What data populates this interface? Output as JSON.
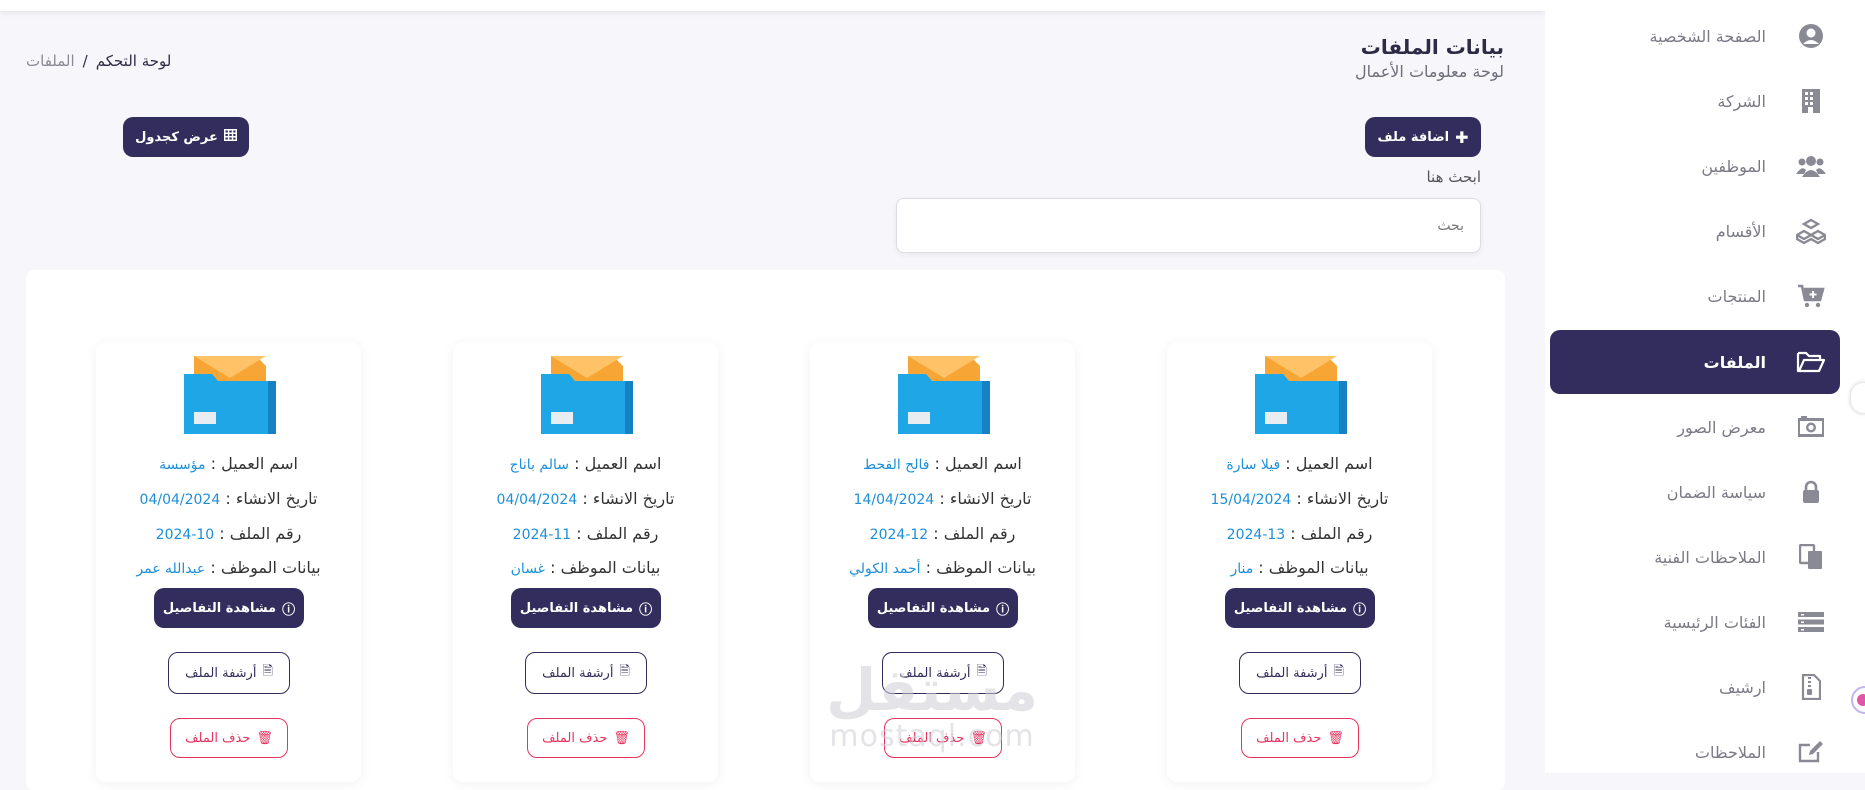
{
  "sidebar": {
    "items": [
      {
        "label": "الصفحة الشخصية",
        "icon": "user-circle-icon"
      },
      {
        "label": "الشركة",
        "icon": "building-icon"
      },
      {
        "label": "الموظفين",
        "icon": "users-icon"
      },
      {
        "label": "الأقسام",
        "icon": "cubes-icon"
      },
      {
        "label": "المنتجات",
        "icon": "cart-plus-icon"
      },
      {
        "label": "الملفات",
        "icon": "folder-open-icon",
        "active": true
      },
      {
        "label": "معرض الصور",
        "icon": "camera-icon"
      },
      {
        "label": "سياسة الضمان",
        "icon": "lock-icon"
      },
      {
        "label": "الملاحظات الفنية",
        "icon": "copy-icon"
      },
      {
        "label": "الفئات الرئيسية",
        "icon": "list-icon"
      },
      {
        "label": "ارشيف",
        "icon": "file-archive-icon"
      },
      {
        "label": "الملاحظات",
        "icon": "edit-icon"
      }
    ]
  },
  "header": {
    "title": "بيانات الملفات",
    "subtitle": "لوحة معلومات الأعمال",
    "breadcrumb": {
      "home": "لوحة التحكم",
      "separator": "/",
      "current": "الملفات"
    }
  },
  "toolbar": {
    "add_label": "اضافة ملف",
    "table_view_label": "عرض كجدول"
  },
  "search": {
    "label": "ابحث هنا",
    "placeholder": "بحث",
    "value": ""
  },
  "labels": {
    "client": "اسم العميل :",
    "created": "تاريخ الانشاء :",
    "file_no": "رقم الملف :",
    "employee": "بيانات الموظف :",
    "details": "مشاهدة التفاصيل",
    "archive": "أرشفة الملف",
    "delete": "حذف الملف"
  },
  "cards": [
    {
      "client": "فيلا سارة",
      "date": "15/04/2024",
      "file_no": "13-2024",
      "employee": "منار"
    },
    {
      "client": "فالح القحط",
      "date": "14/04/2024",
      "file_no": "12-2024",
      "employee": "أحمد الكولي"
    },
    {
      "client": "سالم باناج",
      "date": "04/04/2024",
      "file_no": "11-2024",
      "employee": "غسان"
    },
    {
      "client": "مؤسسة",
      "date": "04/04/2024",
      "file_no": "10-2024",
      "employee": "عبدالله عمر"
    }
  ],
  "watermark": {
    "arabic": "مستقل",
    "latin": "mostaql.com"
  },
  "colors": {
    "primary": "#322d5c",
    "accent_blue": "#1d8fd9",
    "danger": "#e8335f",
    "folder_blue": "#1ea6e6",
    "folder_orange": "#f7a535"
  }
}
